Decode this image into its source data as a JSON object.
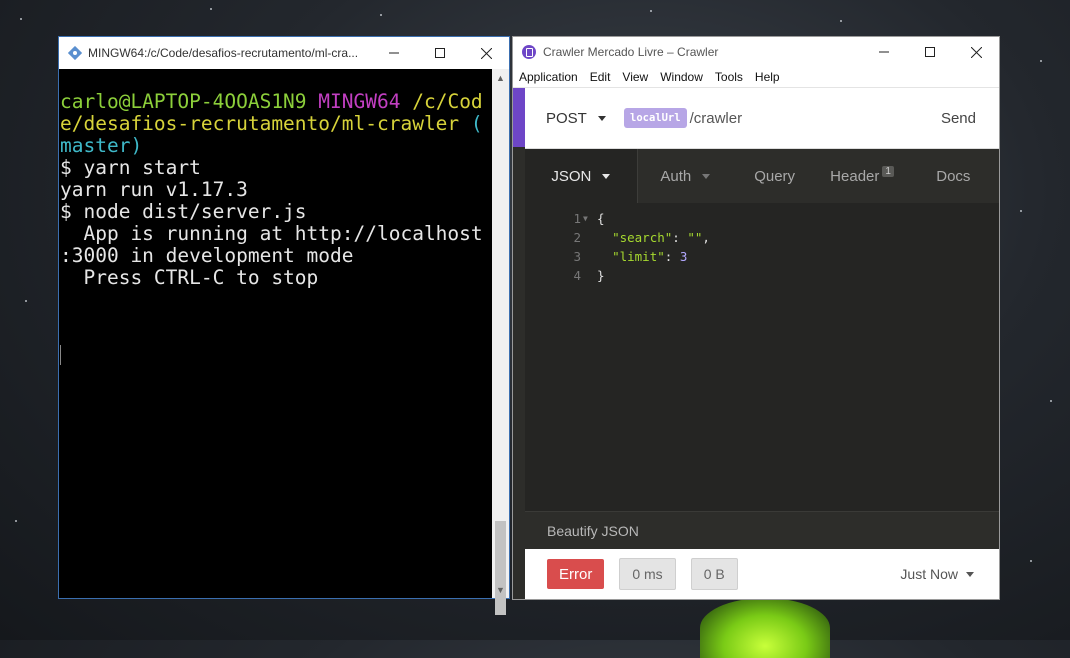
{
  "terminal": {
    "title": "MINGW64:/c/Code/desafios-recrutamento/ml-cra...",
    "prompt_user": "carlo@LAPTOP-4OOAS1N9",
    "prompt_shell": "MINGW64",
    "prompt_path_1": "/c/Cod",
    "prompt_path_2": "e/desafios-recrutamento/ml-crawler",
    "prompt_branch_1": "(",
    "prompt_branch_2": "master)",
    "lines": [
      "$ yarn start",
      "yarn run v1.17.3",
      "$ node dist/server.js",
      "  App is running at http://localhost",
      ":3000 in development mode",
      "  Press CTRL-C to stop"
    ]
  },
  "insomnia": {
    "title": "Crawler Mercado Livre – Crawler",
    "menu": [
      "Application",
      "Edit",
      "View",
      "Window",
      "Tools",
      "Help"
    ],
    "method": "POST",
    "url_env_tag": "localUrl",
    "url_path": "/crawler",
    "send_label": "Send",
    "tabs": {
      "body": "JSON",
      "auth": "Auth",
      "query": "Query",
      "header": "Header",
      "header_count": "1",
      "docs": "Docs"
    },
    "editor": {
      "line_numbers": [
        "1",
        "2",
        "3",
        "4"
      ],
      "open_brace": "{",
      "key_search": "\"search\"",
      "val_search": "\"\"",
      "key_limit": "\"limit\"",
      "val_limit": "3",
      "close_brace": "}"
    },
    "beautify_label": "Beautify JSON",
    "response": {
      "status": "Error",
      "time": "0 ms",
      "size": "0 B",
      "history": "Just Now"
    }
  },
  "colors": {
    "accent": "#6e46c7",
    "error": "#d94d4d",
    "json_key": "#a6d92f",
    "json_number": "#b3a8ff"
  }
}
